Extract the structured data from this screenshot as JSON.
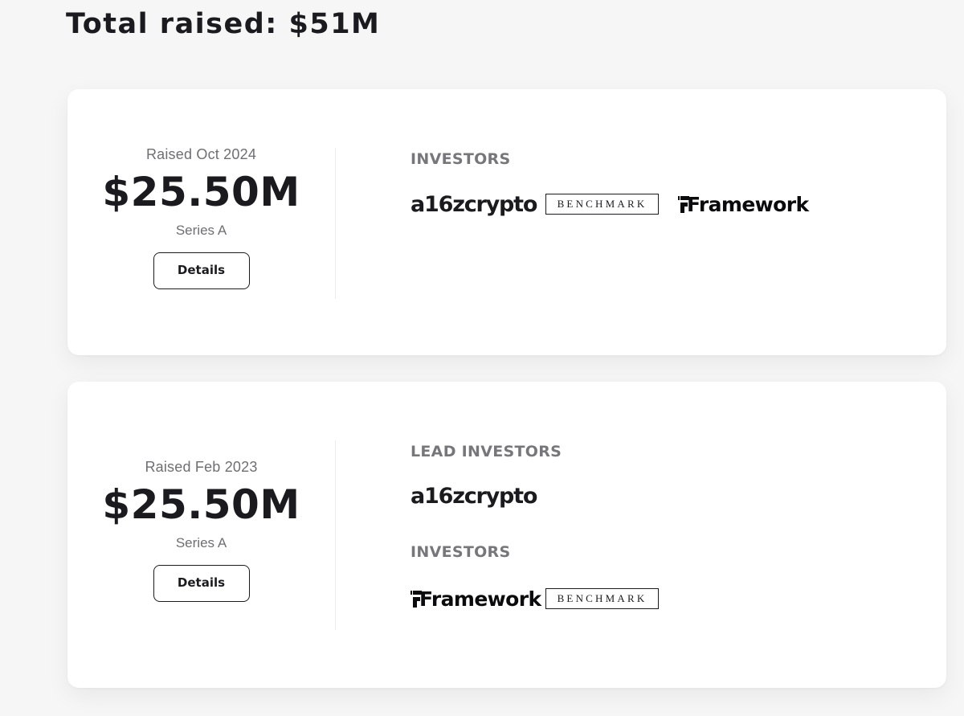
{
  "header": {
    "total_raised": "Total raised: $51M"
  },
  "rounds": [
    {
      "raised_date": "Raised Oct 2024",
      "amount": "$25.50M",
      "round": "Series A",
      "details_label": "Details",
      "investors_label": "INVESTORS",
      "investors": [
        "a16zcrypto",
        "BENCHMARK",
        "Framework"
      ]
    },
    {
      "raised_date": "Raised Feb 2023",
      "amount": "$25.50M",
      "round": "Series A",
      "details_label": "Details",
      "lead_investors_label": "LEAD INVESTORS",
      "lead_investors": [
        "a16zcrypto"
      ],
      "investors_label": "INVESTORS",
      "investors": [
        "Framework",
        "BENCHMARK"
      ]
    }
  ]
}
